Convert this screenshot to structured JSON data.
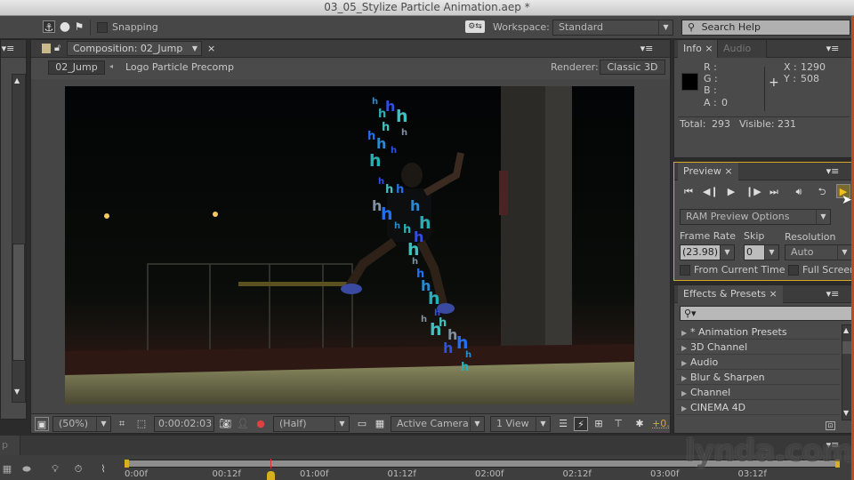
{
  "window": {
    "title": "03_05_Stylize Particle Animation.aep *"
  },
  "toolbar": {
    "icons": [
      "anchor-tool-icon",
      "sphere-icon",
      "flag-tool-icon",
      "workspace-settings-icon"
    ],
    "snapping_label": "Snapping",
    "snapping_checked": false,
    "workspace_label": "Workspace:",
    "workspace_value": "Standard",
    "search_placeholder": "Search Help"
  },
  "composition": {
    "tab_label": "Composition: 02_Jump",
    "breadcrumb": [
      "02_Jump",
      "Logo Particle Precomp"
    ],
    "renderer_label": "Renderer:",
    "renderer_value": "Classic 3D",
    "footer": {
      "zoom": "(50%)",
      "timecode": "0:00:02:03",
      "resolution": "(Half)",
      "camera": "Active Camera",
      "views": "1 View",
      "exposure": "+0."
    }
  },
  "info": {
    "tabs": [
      "Info",
      "Audio"
    ],
    "r_label": "R :",
    "g_label": "G :",
    "b_label": "B :",
    "a_label": "A :",
    "a_value": "0",
    "x_label": "X :",
    "x_value": "1290",
    "y_label": "Y :",
    "y_value": "508",
    "total_label": "Total:",
    "total": "293",
    "visible_label": "Visible:",
    "visible": "231",
    "swatch_color": "#000000"
  },
  "preview": {
    "tab": "Preview",
    "controls": [
      "first-frame",
      "previous-frame",
      "play",
      "next-frame",
      "last-frame",
      "audio",
      "loop",
      "ram-preview"
    ],
    "options_dropdown": "RAM Preview Options",
    "frame_rate_label": "Frame Rate",
    "frame_rate_value": "(23.98)",
    "skip_label": "Skip",
    "skip_value": "0",
    "resolution_label": "Resolution",
    "resolution_value": "Auto",
    "from_current_time_label": "From Current Time",
    "full_screen_label": "Full Screen",
    "accent_color": "#d6a823"
  },
  "effects": {
    "tab": "Effects & Presets",
    "search_placeholder": "",
    "items": [
      "* Animation Presets",
      "3D Channel",
      "Audio",
      "Blur & Sharpen",
      "Channel",
      "CINEMA 4D"
    ]
  },
  "timeline": {
    "tick_labels": [
      "0:00f",
      "00:12f",
      "01:00f",
      "01:12f",
      "02:00f",
      "02:12f",
      "03:00f",
      "03:12f"
    ],
    "tab_fragment": "p"
  },
  "watermark": "lynda.com"
}
